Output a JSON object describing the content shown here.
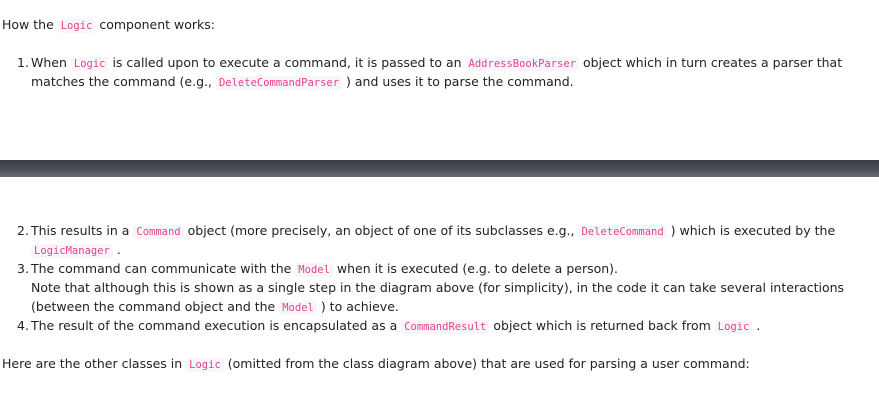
{
  "intro": {
    "pre": "How the ",
    "code": "Logic",
    "post": " component works:"
  },
  "step1": {
    "number": "1.",
    "l1a": "When ",
    "c1": "Logic",
    "l1b": " is called upon to execute a command, it is passed to an ",
    "c2": "AddressBookParser",
    "l1c": " object which in turn creates a parser that",
    "l2a": "matches the command (e.g., ",
    "c3": "DeleteCommandParser",
    "l2b": " ) and uses it to parse the command."
  },
  "step2": {
    "number": "2.",
    "l1a": "This results in a ",
    "c1": "Command",
    "l1b": " object (more precisely, an object of one of its subclasses e.g., ",
    "c2": "DeleteCommand",
    "l1c": " ) which is executed by the",
    "c3": "LogicManager",
    "l2b": " ."
  },
  "step3": {
    "number": "3.",
    "l1a": "The command can communicate with the ",
    "c1": "Model",
    "l1b": " when it is executed (e.g. to delete a person).",
    "l2": "Note that although this is shown as a single step in the diagram above (for simplicity), in the code it can take several interactions",
    "l3a": "(between the command object and the ",
    "c2": "Model",
    "l3b": " ) to achieve."
  },
  "step4": {
    "number": "4.",
    "l1a": "The result of the command execution is encapsulated as a ",
    "c1": "CommandResult",
    "l1b": " object which is returned back from ",
    "c2": "Logic",
    "l1c": " ."
  },
  "outro": {
    "pre": "Here are the other classes in ",
    "code": "Logic",
    "post": " (omitted from the class diagram above) that are used for parsing a user command:"
  }
}
